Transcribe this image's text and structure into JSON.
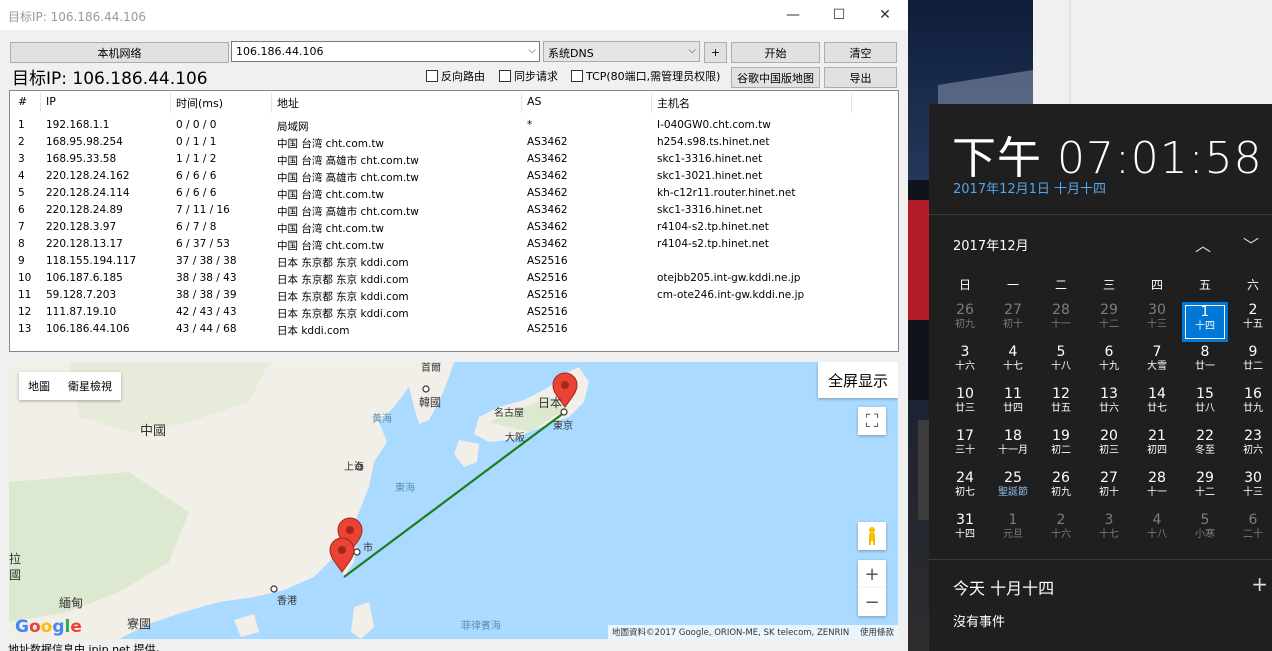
{
  "window": {
    "title": "目标IP: 106.186.44.106",
    "minimize": "—",
    "maximize": "☐",
    "close": "✕"
  },
  "toolbar": {
    "local_network_label": "本机网络",
    "ip_input_value": "106.186.44.106",
    "dns_select_value": "系统DNS",
    "add_label": "+",
    "start_label": "开始",
    "clear_label": "清空",
    "google_map_label": "谷歌中国版地图",
    "export_label": "导出"
  },
  "target_heading": "目标IP: 106.186.44.106",
  "options": {
    "reverse_route": "反向路由",
    "sync_request": "同步请求",
    "tcp_mode": "TCP(80端口,需管理员权限)"
  },
  "table": {
    "headers": [
      "#",
      "IP",
      "时间(ms)",
      "地址",
      "AS",
      "主机名"
    ],
    "rows": [
      [
        "1",
        "192.168.1.1",
        "0 / 0 / 0",
        "局域网",
        "*",
        "I-040GW0.cht.com.tw"
      ],
      [
        "2",
        "168.95.98.254",
        "0 / 1 / 1",
        "中国 台湾 cht.com.tw",
        "AS3462",
        "h254.s98.ts.hinet.net"
      ],
      [
        "3",
        "168.95.33.58",
        "1 / 1 / 2",
        "中国 台湾 高雄市 cht.com.tw",
        "AS3462",
        "skc1-3316.hinet.net"
      ],
      [
        "4",
        "220.128.24.162",
        "6 / 6 / 6",
        "中国 台湾 高雄市 cht.com.tw",
        "AS3462",
        "skc1-3021.hinet.net"
      ],
      [
        "5",
        "220.128.24.114",
        "6 / 6 / 6",
        "中国 台湾 cht.com.tw",
        "AS3462",
        "kh-c12r11.router.hinet.net"
      ],
      [
        "6",
        "220.128.24.89",
        "7 / 11 / 16",
        "中国 台湾 高雄市 cht.com.tw",
        "AS3462",
        "skc1-3316.hinet.net"
      ],
      [
        "7",
        "220.128.3.97",
        "6 / 7 / 8",
        "中国 台湾 cht.com.tw",
        "AS3462",
        "r4104-s2.tp.hinet.net"
      ],
      [
        "8",
        "220.128.13.17",
        "6 / 37 / 53",
        "中国 台湾 cht.com.tw",
        "AS3462",
        "r4104-s2.tp.hinet.net"
      ],
      [
        "9",
        "118.155.194.117",
        "37 / 38 / 38",
        "日本 东京都 东京 kddi.com",
        "AS2516",
        ""
      ],
      [
        "10",
        "106.187.6.185",
        "38 / 38 / 43",
        "日本 东京都 东京 kddi.com",
        "AS2516",
        "otejbb205.int-gw.kddi.ne.jp"
      ],
      [
        "11",
        "59.128.7.203",
        "38 / 38 / 39",
        "日本 东京都 东京 kddi.com",
        "AS2516",
        "cm-ote246.int-gw.kddi.ne.jp"
      ],
      [
        "12",
        "111.87.19.10",
        "42 / 43 / 43",
        "日本 东京都 东京 kddi.com",
        "AS2516",
        ""
      ],
      [
        "13",
        "106.186.44.106",
        "43 / 44 / 68",
        "日本 kddi.com",
        "AS2516",
        ""
      ]
    ]
  },
  "map": {
    "type_map": "地圖",
    "type_satellite": "衛星檢視",
    "fullscreen_label": "全屏显示",
    "zoom_in": "+",
    "zoom_out": "−",
    "labels": {
      "china": "中國",
      "korea": "韓國",
      "seoul": "首爾",
      "yellow_sea": "黃海",
      "east_sea": "東海",
      "shanghai": "上海",
      "nagoya": "名古屋",
      "osaka": "大阪",
      "japan": "日本",
      "tokyo": "東京",
      "taipei": "市",
      "hongkong": "香港",
      "myanmar": "緬甸",
      "laos": "寮國",
      "philippine_sea": "菲律賓海",
      "edge_la": "拉",
      "edge_guo": "國"
    },
    "google_logo": "Google",
    "attribution": "地圖資料©2017 Google, ORION-ME, SK telecom, ZENRIN",
    "terms": "使用條款",
    "route_color": "#1a7f1a"
  },
  "footer_note": "地址数据信息由 ipip.net 提供。",
  "calendar": {
    "time": "下午 07:01:58",
    "long_date": "2017年12月1日 十月十四",
    "month_title": "2017年12月",
    "weekdays": [
      "日",
      "一",
      "二",
      "三",
      "四",
      "五",
      "六"
    ],
    "days": [
      [
        "26",
        "初九",
        "other"
      ],
      [
        "27",
        "初十",
        "other"
      ],
      [
        "28",
        "十一",
        "other"
      ],
      [
        "29",
        "十二",
        "other"
      ],
      [
        "30",
        "十三",
        "other"
      ],
      [
        "1",
        "十四",
        "today"
      ],
      [
        "2",
        "十五",
        ""
      ],
      [
        "3",
        "十六",
        ""
      ],
      [
        "4",
        "十七",
        ""
      ],
      [
        "5",
        "十八",
        ""
      ],
      [
        "6",
        "十九",
        ""
      ],
      [
        "7",
        "大雪",
        ""
      ],
      [
        "8",
        "廿一",
        ""
      ],
      [
        "9",
        "廿二",
        ""
      ],
      [
        "10",
        "廿三",
        ""
      ],
      [
        "11",
        "廿四",
        ""
      ],
      [
        "12",
        "廿五",
        ""
      ],
      [
        "13",
        "廿六",
        ""
      ],
      [
        "14",
        "廿七",
        ""
      ],
      [
        "15",
        "廿八",
        ""
      ],
      [
        "16",
        "廿九",
        ""
      ],
      [
        "17",
        "三十",
        ""
      ],
      [
        "18",
        "十一月",
        ""
      ],
      [
        "19",
        "初二",
        ""
      ],
      [
        "20",
        "初三",
        ""
      ],
      [
        "21",
        "初四",
        ""
      ],
      [
        "22",
        "冬至",
        ""
      ],
      [
        "23",
        "初六",
        ""
      ],
      [
        "24",
        "初七",
        ""
      ],
      [
        "25",
        "聖誕節",
        "holiday"
      ],
      [
        "26",
        "初九",
        ""
      ],
      [
        "27",
        "初十",
        ""
      ],
      [
        "28",
        "十一",
        ""
      ],
      [
        "29",
        "十二",
        ""
      ],
      [
        "30",
        "十三",
        ""
      ],
      [
        "31",
        "十四",
        ""
      ],
      [
        "1",
        "元旦",
        "other"
      ],
      [
        "2",
        "十六",
        "other"
      ],
      [
        "3",
        "十七",
        "other"
      ],
      [
        "4",
        "十八",
        "other"
      ],
      [
        "5",
        "小寒",
        "other"
      ],
      [
        "6",
        "二十",
        "other"
      ]
    ],
    "today_line": "今天 十月十四",
    "add_event": "+",
    "no_events": "沒有事件",
    "accent": "#0078d7"
  }
}
